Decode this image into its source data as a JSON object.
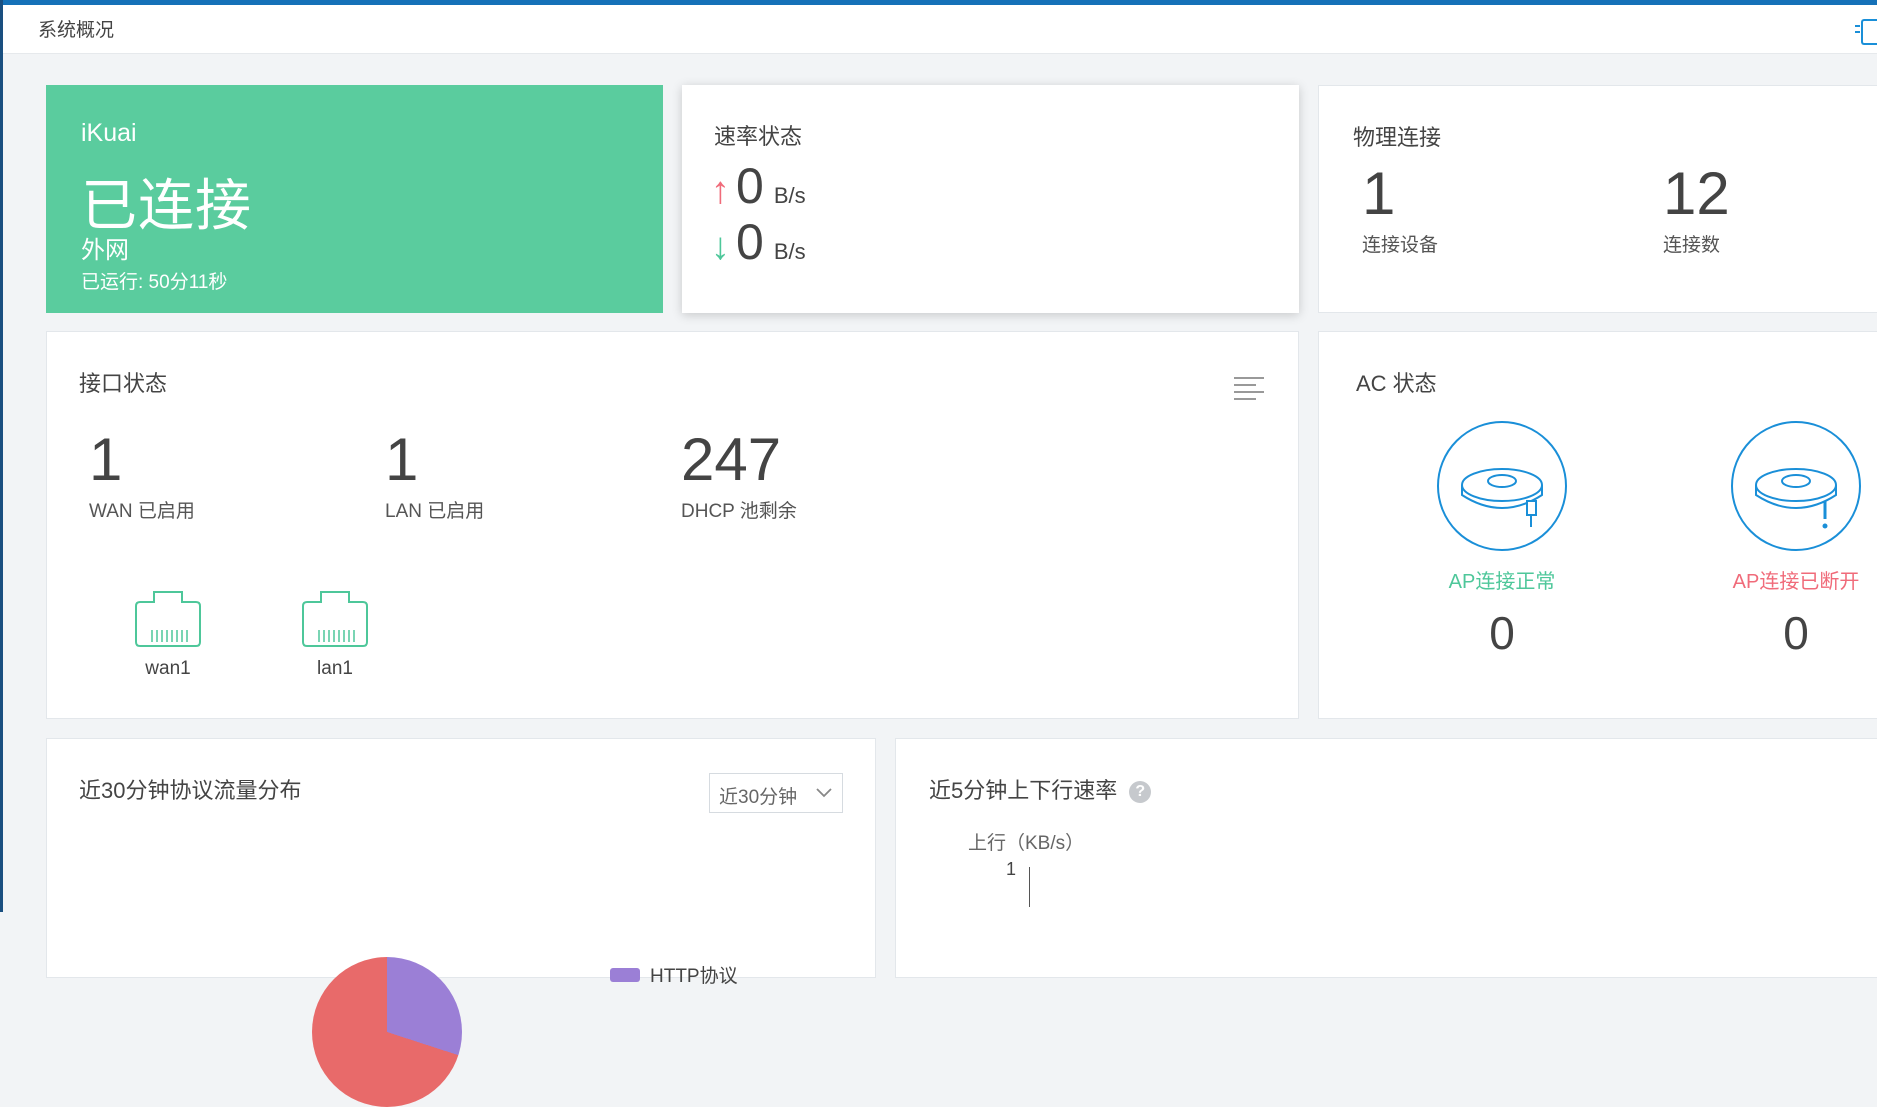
{
  "header": {
    "title": "系统概况"
  },
  "connection": {
    "brand": "iKuai",
    "status": "已连接",
    "network": "外网",
    "uptime": "已运行: 50分11秒"
  },
  "rate": {
    "title": "速率状态",
    "up_arrow": "↑",
    "down_arrow": "↓",
    "up_value": "0",
    "down_value": "0",
    "unit": "B/s"
  },
  "physical": {
    "title": "物理连接",
    "devices_value": "1",
    "devices_label": "连接设备",
    "connections_value": "12",
    "connections_label": "连接数"
  },
  "interface": {
    "title": "接口状态",
    "wan_value": "1",
    "wan_label": "WAN 已启用",
    "lan_value": "1",
    "lan_label": "LAN 已启用",
    "dhcp_value": "247",
    "dhcp_label": "DHCP 池剩余",
    "ports": [
      {
        "label": "wan1"
      },
      {
        "label": "lan1"
      }
    ]
  },
  "ac": {
    "title": "AC 状态",
    "ok_label": "AP连接正常",
    "ok_count": "0",
    "bad_label": "AP连接已断开",
    "bad_count": "0"
  },
  "protocol": {
    "title": "近30分钟协议流量分布",
    "select_value": "近30分钟",
    "legend_item": "HTTP协议"
  },
  "rate5": {
    "title": "近5分钟上下行速率",
    "help": "?",
    "axis_label": "上行（KB/s）",
    "tick": "1"
  },
  "colors": {
    "accent_blue": "#1a8fd8",
    "green": "#5acc9e",
    "red": "#f06b7a"
  }
}
